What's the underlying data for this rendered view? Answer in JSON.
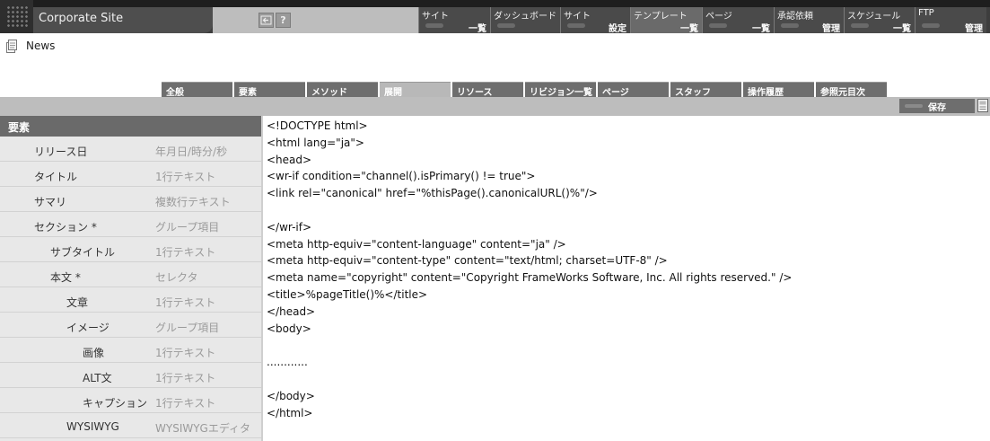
{
  "header": {
    "site_title": "Corporate Site",
    "back_icon": "back-arrow-icon",
    "help_label": "?"
  },
  "nav": [
    {
      "top": "サイト",
      "bottom": "一覧"
    },
    {
      "top": "ダッシュボード",
      "bottom": ""
    },
    {
      "top": "サイト",
      "bottom": "設定"
    },
    {
      "top": "テンプレート",
      "bottom": "一覧"
    },
    {
      "top": "ページ",
      "bottom": "一覧"
    },
    {
      "top": "承認依頼",
      "bottom": "管理"
    },
    {
      "top": "スケジュール",
      "bottom": "一覧"
    },
    {
      "top": "FTP",
      "bottom": "管理"
    }
  ],
  "breadcrumb": {
    "label": "News"
  },
  "tabs": [
    "全般",
    "要素",
    "メソッド",
    "展開",
    "リソース",
    "リビジョン一覧",
    "ページ",
    "スタッフ",
    "操作履歴",
    "参照元目次"
  ],
  "active_tab": "展開",
  "toolbar": {
    "save_label": "保存"
  },
  "elements_panel": {
    "heading": "要素",
    "rows": [
      {
        "name": "リリース日",
        "type": "年月日/時分/秒"
      },
      {
        "name": "タイトル",
        "type": "1行テキスト"
      },
      {
        "name": "サマリ",
        "type": "複数行テキスト"
      },
      {
        "name": "セクション *",
        "type": "グループ項目"
      },
      {
        "name": "サブタイトル",
        "type": "1行テキスト"
      },
      {
        "name": "本文 *",
        "type": "セレクタ"
      },
      {
        "name": "文章",
        "type": "1行テキスト"
      },
      {
        "name": "イメージ",
        "type": "グループ項目"
      },
      {
        "name": "画像",
        "type": "1行テキスト"
      },
      {
        "name": "ALT文",
        "type": "1行テキスト"
      },
      {
        "name": "キャプション",
        "type": "1行テキスト"
      },
      {
        "name": "WYSIWYG",
        "type": "WYSIWYGエディタ"
      }
    ]
  },
  "code": [
    "<!DOCTYPE html>",
    "<html lang=\"ja\">",
    "<head>",
    "<wr-if condition=\"channel().isPrimary() != true\">",
    "<link rel=\"canonical\" href=\"%thisPage().canonicalURL()%\"/>",
    "",
    "</wr-if>",
    "<meta http-equiv=\"content-language\" content=\"ja\" />",
    "<meta http-equiv=\"content-type\" content=\"text/html; charset=UTF-8\" />",
    "<meta name=\"copyright\" content=\"Copyright FrameWorks Software, Inc. All rights reserved.\" />",
    "<title>%pageTitle()%</title>",
    "</head>",
    "<body>",
    "",
    "............",
    "",
    "</body>",
    "</html>"
  ]
}
